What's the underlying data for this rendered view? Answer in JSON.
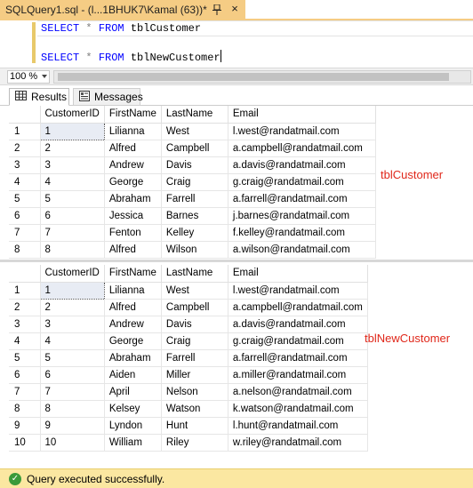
{
  "tab": {
    "title": "SQLQuery1.sql - (l...1BHUK7\\Kamal (63))*",
    "close_glyph": "×"
  },
  "editor": {
    "line1": {
      "kw1": "SELECT",
      "star": "*",
      "kw2": "FROM",
      "table": "tblCustomer"
    },
    "line2": {
      "kw1": "SELECT",
      "star": "*",
      "kw2": "FROM",
      "table": "tblNewCustomer"
    }
  },
  "zoom": {
    "value": "100 %"
  },
  "result_tabs": {
    "results": "Results",
    "messages": "Messages"
  },
  "grid1": {
    "columns": [
      "CustomerID",
      "FirstName",
      "LastName",
      "Email"
    ],
    "rows": [
      [
        "1",
        "1",
        "Lilianna",
        "West",
        "l.west@randatmail.com"
      ],
      [
        "2",
        "2",
        "Alfred",
        "Campbell",
        "a.campbell@randatmail.com"
      ],
      [
        "3",
        "3",
        "Andrew",
        "Davis",
        "a.davis@randatmail.com"
      ],
      [
        "4",
        "4",
        "George",
        "Craig",
        "g.craig@randatmail.com"
      ],
      [
        "5",
        "5",
        "Abraham",
        "Farrell",
        "a.farrell@randatmail.com"
      ],
      [
        "6",
        "6",
        "Jessica",
        "Barnes",
        "j.barnes@randatmail.com"
      ],
      [
        "7",
        "7",
        "Fenton",
        "Kelley",
        "f.kelley@randatmail.com"
      ],
      [
        "8",
        "8",
        "Alfred",
        "Wilson",
        "a.wilson@randatmail.com"
      ]
    ],
    "label": "tblCustomer"
  },
  "grid2": {
    "columns": [
      "CustomerID",
      "FirstName",
      "LastName",
      "Email"
    ],
    "rows": [
      [
        "1",
        "1",
        "Lilianna",
        "West",
        "l.west@randatmail.com"
      ],
      [
        "2",
        "2",
        "Alfred",
        "Campbell",
        "a.campbell@randatmail.com"
      ],
      [
        "3",
        "3",
        "Andrew",
        "Davis",
        "a.davis@randatmail.com"
      ],
      [
        "4",
        "4",
        "George",
        "Craig",
        "g.craig@randatmail.com"
      ],
      [
        "5",
        "5",
        "Abraham",
        "Farrell",
        "a.farrell@randatmail.com"
      ],
      [
        "6",
        "6",
        "Aiden",
        "Miller",
        "a.miller@randatmail.com"
      ],
      [
        "7",
        "7",
        "April",
        "Nelson",
        "a.nelson@randatmail.com"
      ],
      [
        "8",
        "8",
        "Kelsey",
        "Watson",
        "k.watson@randatmail.com"
      ],
      [
        "9",
        "9",
        "Lyndon",
        "Hunt",
        "l.hunt@randatmail.com"
      ],
      [
        "10",
        "10",
        "William",
        "Riley",
        "w.riley@randatmail.com"
      ]
    ],
    "label": "tblNewCustomer"
  },
  "status": {
    "message": "Query executed successfully."
  },
  "colors": {
    "tab_bg": "#f5cc84",
    "status_bg": "#fbe7a1",
    "keyword": "#0000ff",
    "annotation": "#e0271a"
  }
}
